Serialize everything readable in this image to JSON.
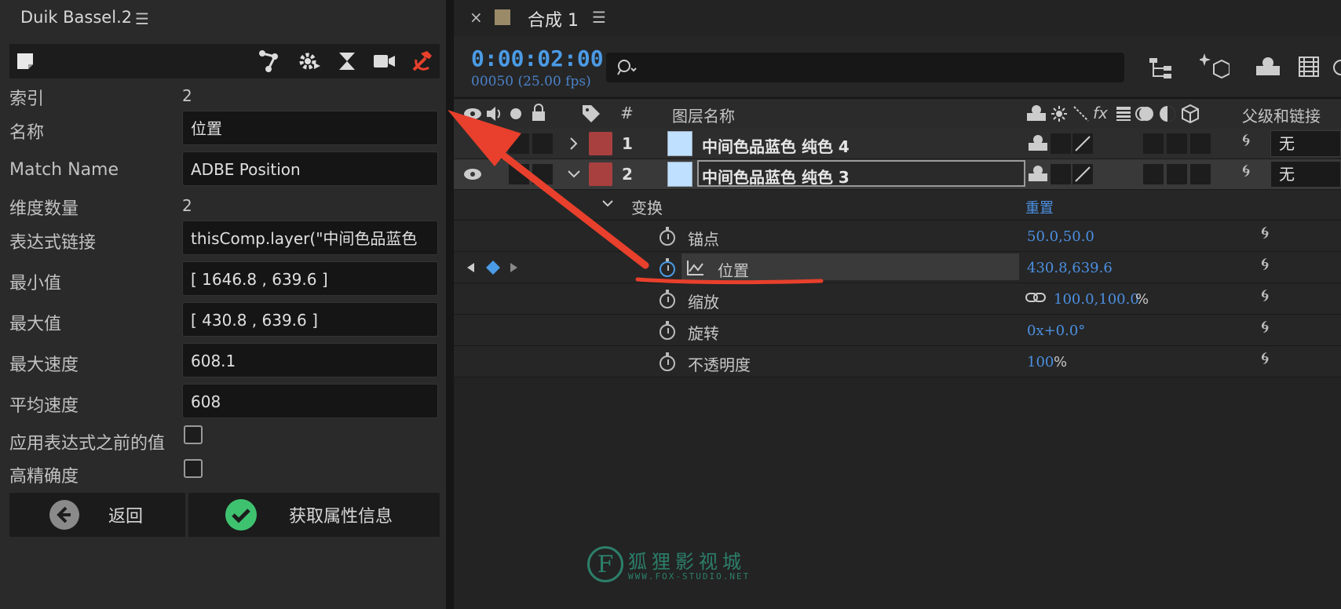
{
  "left_panel": {
    "title": "Duik Bassel.2",
    "menu": "☰",
    "properties": [
      {
        "label": "索引",
        "value": "2"
      },
      {
        "label": "名称",
        "value": "位置"
      },
      {
        "label": "Match Name",
        "value": "ADBE Position"
      },
      {
        "label": "维度数量",
        "value": "2"
      },
      {
        "label": "表达式链接",
        "value": "thisComp.layer(\"中间色品蓝色"
      },
      {
        "label": "最小值",
        "value": "[ 1646.8 , 639.6 ]"
      },
      {
        "label": "最大值",
        "value": "[ 430.8 , 639.6 ]"
      },
      {
        "label": "最大速度",
        "value": "608.1"
      },
      {
        "label": "平均速度",
        "value": "608"
      }
    ],
    "checkbox_pre_expression": "应用表达式之前的值",
    "checkbox_high_precision": "高精确度",
    "back_label": "返回",
    "get_info_label": "获取属性信息"
  },
  "tab": {
    "close": "×",
    "name": "合成 1",
    "menu": "☰"
  },
  "timeline": {
    "time": "0:00:02:00",
    "frames": "00050 (25.00 fps)",
    "search_placeholder": ""
  },
  "headers": {
    "number": "#",
    "layer_name": "图层名称",
    "fx": "fx",
    "parent": "父级和链接"
  },
  "layers": [
    {
      "number": "1",
      "name": "中间色品蓝色 纯色 4",
      "parent": "无"
    },
    {
      "number": "2",
      "name": "中间色品蓝色 纯色 3",
      "parent": "无"
    }
  ],
  "transform": {
    "group": "变换",
    "reset": "重置",
    "anchor_label": "锚点",
    "anchor_value": "50.0,50.0",
    "position_label": "位置",
    "position_value": "430.8,639.6",
    "scale_label": "缩放",
    "scale_value": "100.0,100.0",
    "scale_unit": "%",
    "rotation_label": "旋转",
    "rotation_value": "0x+0.0°",
    "opacity_label": "不透明度",
    "opacity_value": "100",
    "opacity_unit": "%"
  },
  "watermark": {
    "letter": "F",
    "cn": "狐狸影视城",
    "en": "WWW.FOX-STUDIO.NET"
  },
  "colors": {
    "accent_blue": "#4b9be6",
    "label_red": "#a84040",
    "arrow_red": "#e8402c",
    "solid_blue": "#bfe0ff"
  }
}
